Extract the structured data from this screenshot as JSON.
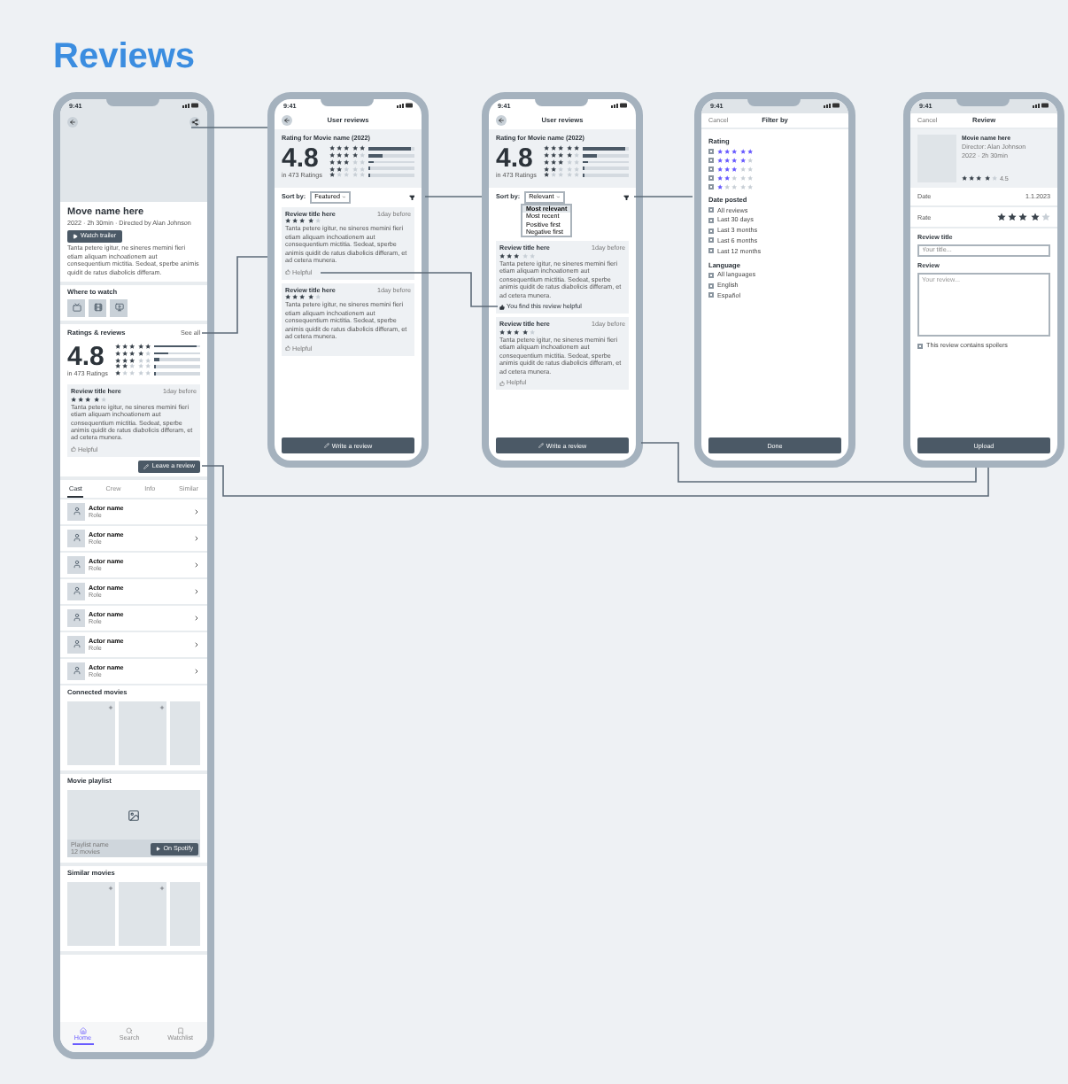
{
  "title": "Reviews",
  "detail": {
    "status_time": "9:41",
    "movie_title": "Move name here",
    "meta": "2022 · 2h 30min · Directed by Alan Johnson",
    "trailer_button": "Watch trailer",
    "synopsis": "Tanta petere igitur, ne sineres memini fieri etiam aliquam inchoationem aut consequentium mictitia. Sedeat, sperbe animis quidit de ratus diabolicis differam.",
    "watch_title": "Where to watch",
    "ratings_title": "Ratings & reviews",
    "see_all": "See all",
    "summary": {
      "rating": "4.8",
      "count": "in 473 Ratings",
      "breakdown": [
        {
          "stars": 5,
          "level": 0.92
        },
        {
          "stars": 4,
          "level": 0.3
        },
        {
          "stars": 3,
          "level": 0.12
        },
        {
          "stars": 2,
          "level": 0.05
        },
        {
          "stars": 1,
          "level": 0.02
        }
      ]
    },
    "review": {
      "title": "Review title here",
      "time": "1day before",
      "stars": 4,
      "text": "Tanta petere igitur, ne sineres memini fieri etiam aliquam inchoationem aut consequentium mictitia. Sedeat, sperbe animis quidit de ratus diabolicis differam, et ad cetera munera.",
      "helpful": "Helpful",
      "helpful_on": false
    },
    "leave_button": "Leave a review",
    "tabs": [
      {
        "label": "Cast",
        "selected": true
      },
      {
        "label": "Crew",
        "selected": false
      },
      {
        "label": "Info",
        "selected": false
      },
      {
        "label": "Similar",
        "selected": false
      }
    ],
    "cast": [
      {
        "name": "Actor name",
        "role": "Role"
      },
      {
        "name": "Actor name",
        "role": "Role"
      },
      {
        "name": "Actor name",
        "role": "Role"
      },
      {
        "name": "Actor name",
        "role": "Role"
      },
      {
        "name": "Actor name",
        "role": "Role"
      },
      {
        "name": "Actor name",
        "role": "Role"
      },
      {
        "name": "Actor name",
        "role": "Role"
      }
    ],
    "connected_title": "Connected movies",
    "playlist_title": "Movie playlist",
    "playlist_name": "Playlist name",
    "playlist_count": "12 movies",
    "spotify_button": "On Spotify",
    "similar_title": "Similar movies",
    "nav": [
      {
        "label": "Home",
        "selected": true
      },
      {
        "label": "Search",
        "selected": false
      },
      {
        "label": "Watchlist",
        "selected": false
      }
    ]
  },
  "reviews_featured": {
    "status_time": "9:41",
    "header": "User reviews",
    "heading": "Rating for Movie name (2022)",
    "summary": {
      "rating": "4.8",
      "count": "in 473 Ratings",
      "breakdown": [
        {
          "stars": 5,
          "level": 0.92
        },
        {
          "stars": 4,
          "level": 0.3
        },
        {
          "stars": 3,
          "level": 0.12
        },
        {
          "stars": 2,
          "level": 0.05
        },
        {
          "stars": 1,
          "level": 0.02
        }
      ]
    },
    "sort_label": "Sort by:",
    "sort_value": "Featured",
    "reviews": [
      {
        "title": "Review title here",
        "time": "1day before",
        "stars": 4,
        "text": "Tanta petere igitur, ne sineres memini fieri etiam aliquam inchoationem aut consequentium mictitia. Sedeat, sperbe animis quidit de ratus diabolicis differam, et ad cetera munera.",
        "helpful": "Helpful",
        "helpful_on": false
      },
      {
        "title": "Review title here",
        "time": "1day before",
        "stars": 4,
        "text": "Tanta petere igitur, ne sineres memini fieri etiam aliquam inchoationem aut consequentium mictitia. Sedeat, sperbe animis quidit de ratus diabolicis differam, et ad cetera munera.",
        "helpful": "Helpful",
        "helpful_on": false
      }
    ],
    "write_button": "Write a review"
  },
  "reviews_relevant": {
    "status_time": "9:41",
    "header": "User reviews",
    "heading": "Rating for Movie name (2022)",
    "summary": {
      "rating": "4.8",
      "count": "in 473 Ratings",
      "breakdown": [
        {
          "stars": 5,
          "level": 0.92
        },
        {
          "stars": 4,
          "level": 0.3
        },
        {
          "stars": 3,
          "level": 0.12
        },
        {
          "stars": 2,
          "level": 0.05
        },
        {
          "stars": 1,
          "level": 0.02
        }
      ]
    },
    "sort_label": "Sort by:",
    "sort_value": "Relevant",
    "sort_options": [
      {
        "label": "Most relevant",
        "selected": true
      },
      {
        "label": "Most recent",
        "selected": false
      },
      {
        "label": "Positive first",
        "selected": false
      },
      {
        "label": "Negative first",
        "selected": false
      }
    ],
    "reviews": [
      {
        "title": "Review title here",
        "time": "1day before",
        "stars": 3,
        "text": "Tanta petere igitur, ne sineres memini fieri etiam aliquam inchoationem aut consequentium mictitia. Sedeat, sperbe animis quidit de ratus diabolicis differam, et ad cetera munera.",
        "helpful": "You find this review helpful",
        "helpful_on": true
      },
      {
        "title": "Review title here",
        "time": "1day before",
        "stars": 4,
        "text": "Tanta petere igitur, ne sineres memini fieri etiam aliquam inchoationem aut consequentium mictitia. Sedeat, sperbe animis quidit de ratus diabolicis differam, et ad cetera munera.",
        "helpful": "Helpful",
        "helpful_on": false
      }
    ],
    "write_button": "Write a review"
  },
  "filter": {
    "status_time": "9:41",
    "cancel": "Cancel",
    "title": "Filter by",
    "rating_title": "Rating",
    "rating_options": [
      {
        "stars": 5,
        "checked": false
      },
      {
        "stars": 4,
        "checked": false
      },
      {
        "stars": 3,
        "checked": false
      },
      {
        "stars": 2,
        "checked": false
      },
      {
        "stars": 1,
        "checked": false
      }
    ],
    "date_title": "Date posted",
    "date_options": [
      {
        "label": "All reviews",
        "checked": false
      },
      {
        "label": "Last 30 days",
        "checked": false
      },
      {
        "label": "Last 3 months",
        "checked": false
      },
      {
        "label": "Last 6 months",
        "checked": false
      },
      {
        "label": "Last 12 months",
        "checked": false
      }
    ],
    "language_title": "Language",
    "language_options": [
      {
        "label": "All languages",
        "checked": false
      },
      {
        "label": "English",
        "checked": false
      },
      {
        "label": "Español",
        "checked": false
      }
    ],
    "done_button": "Done"
  },
  "write": {
    "status_time": "9:41",
    "cancel": "Cancel",
    "title": "Review",
    "movie_title": "Movie name here",
    "director": "Director: Alan Johnson",
    "meta": "2022 · 2h 30min",
    "movie_rating": {
      "stars": 4,
      "text": "4.5"
    },
    "date_label": "Date",
    "date_value": "1.1.2023",
    "rate": {
      "label": "Rate",
      "stars": 4
    },
    "review_title_label": "Review title",
    "review_title_placeholder": "Your title...",
    "review_label": "Review",
    "review_placeholder": "Your review...",
    "spoiler_label": "This review contains spoilers",
    "spoiler_checked": false,
    "upload_button": "Upload"
  }
}
